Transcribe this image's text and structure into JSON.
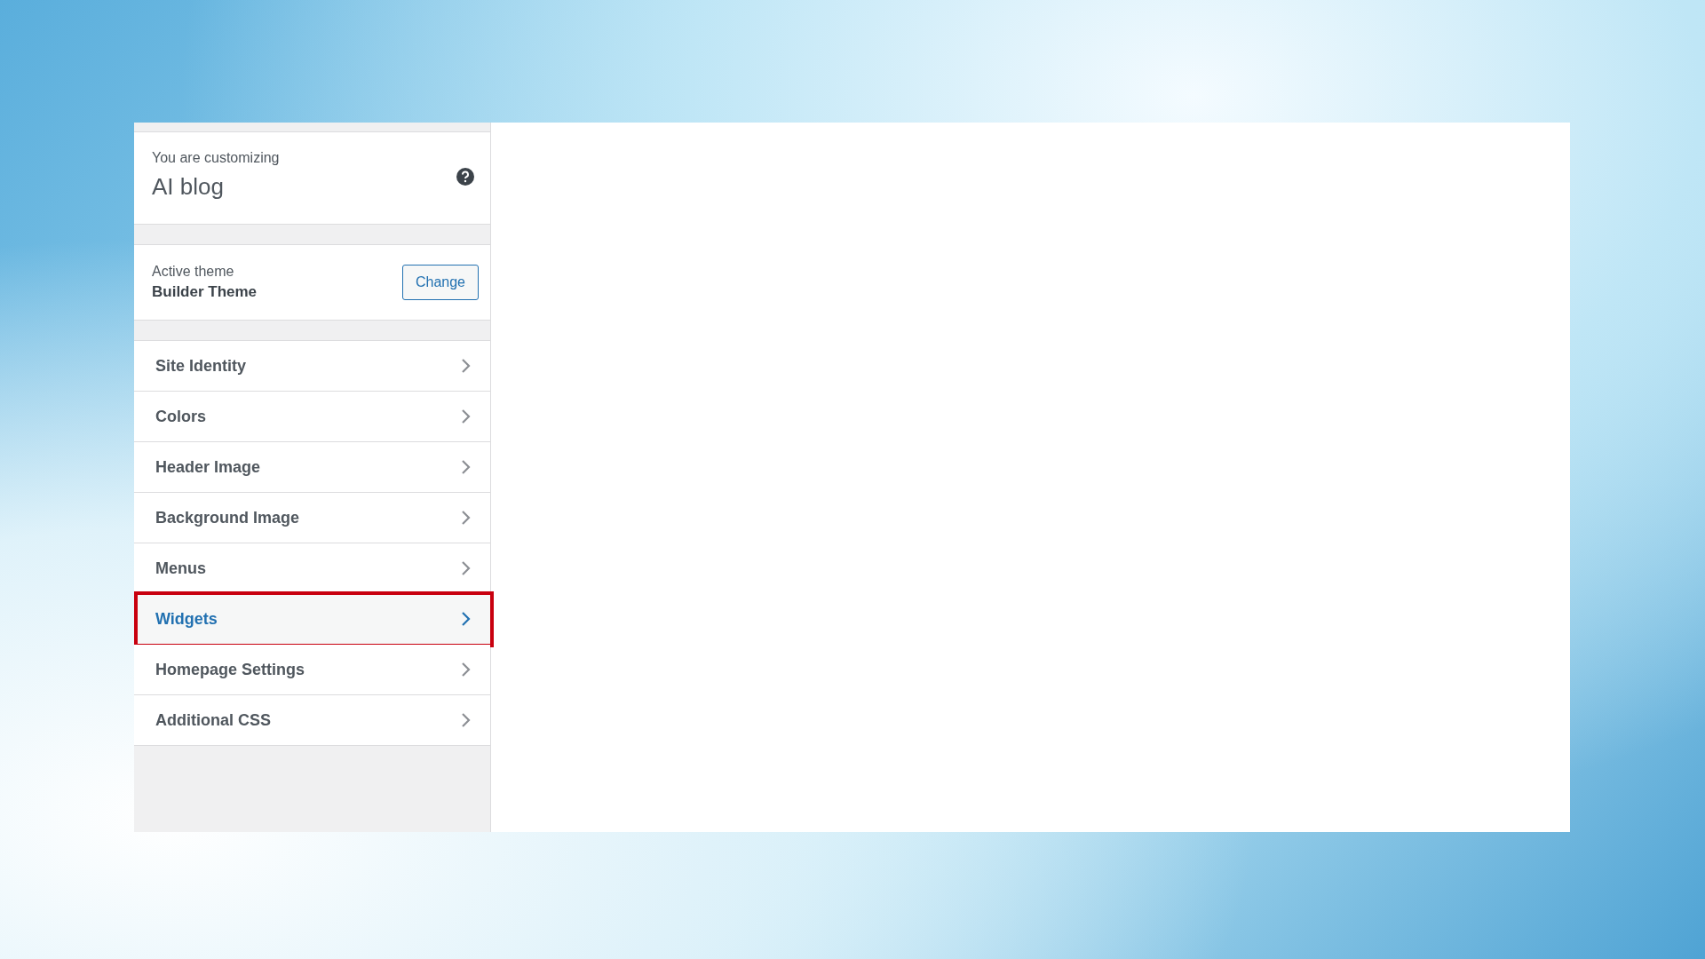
{
  "customizer": {
    "info": {
      "label": "You are customizing",
      "site_title": "AI blog"
    },
    "theme": {
      "label": "Active theme",
      "name": "Builder Theme",
      "button": "Change"
    },
    "sections": [
      {
        "label": "Site Identity",
        "selected": false,
        "outlined": false
      },
      {
        "label": "Colors",
        "selected": false,
        "outlined": false
      },
      {
        "label": "Header Image",
        "selected": false,
        "outlined": false
      },
      {
        "label": "Background Image",
        "selected": false,
        "outlined": false
      },
      {
        "label": "Menus",
        "selected": false,
        "outlined": false
      },
      {
        "label": "Widgets",
        "selected": true,
        "outlined": true
      },
      {
        "label": "Homepage Settings",
        "selected": false,
        "outlined": false
      },
      {
        "label": "Additional CSS",
        "selected": false,
        "outlined": false
      }
    ]
  }
}
